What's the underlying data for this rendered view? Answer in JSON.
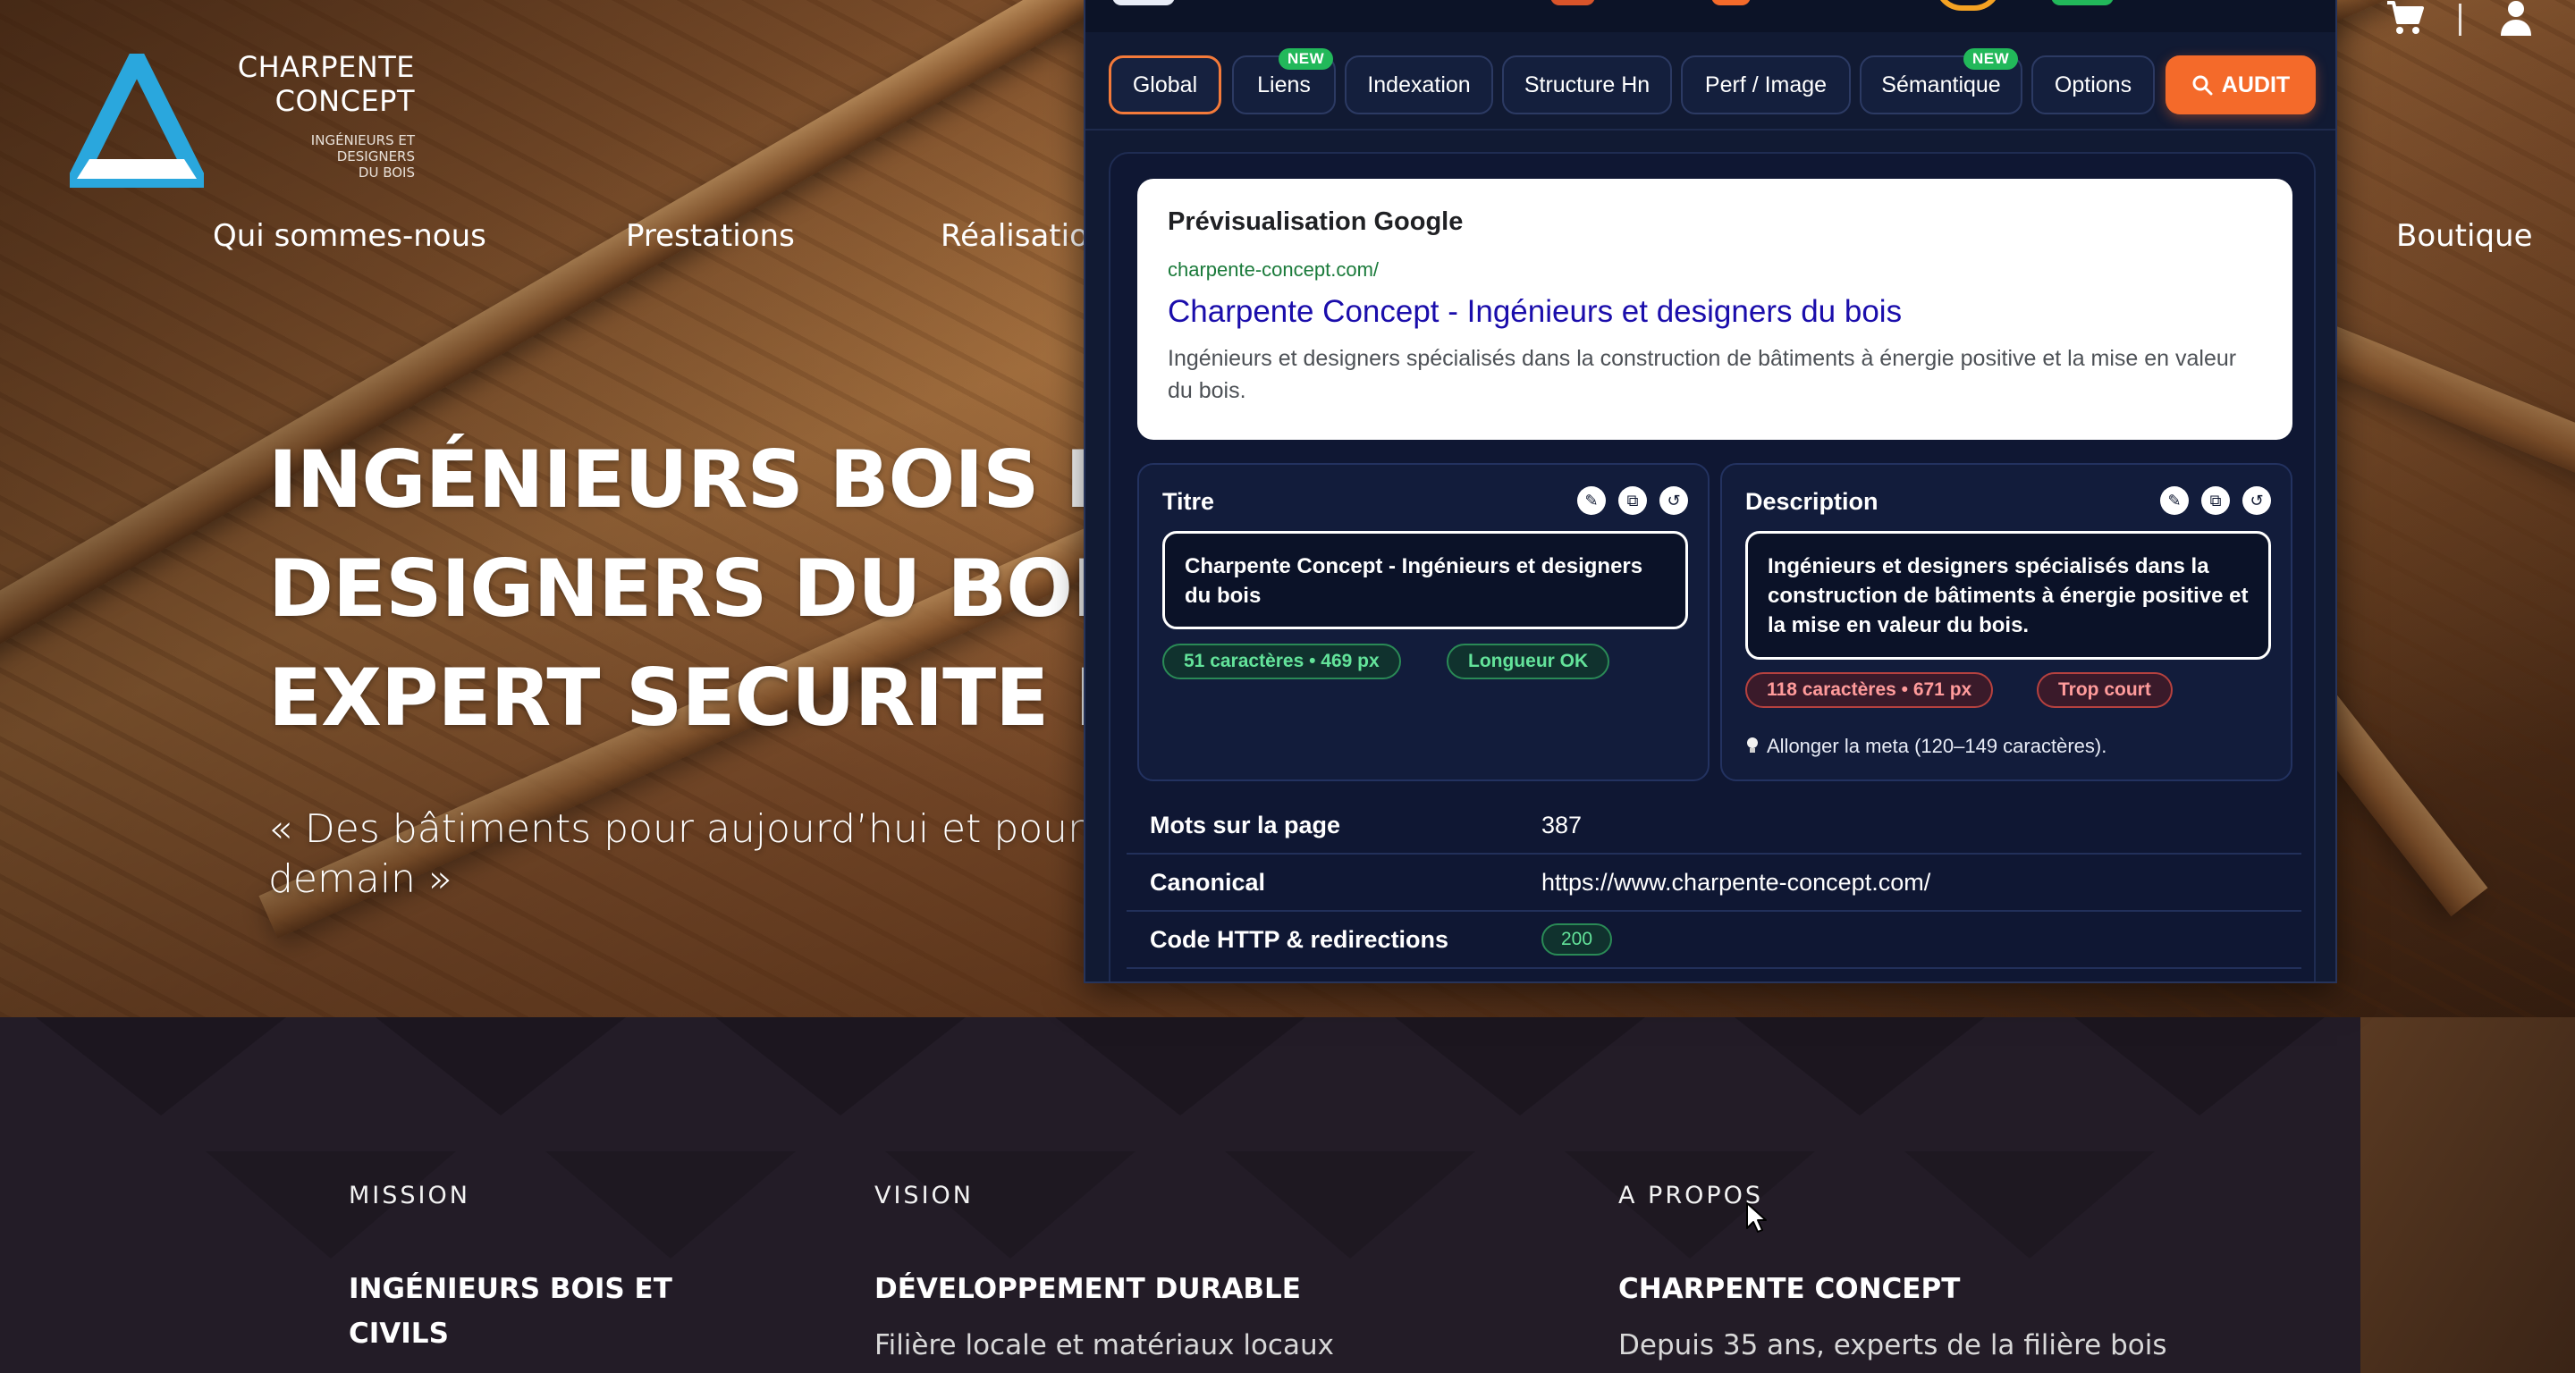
{
  "site": {
    "logo": {
      "title_line1": "CHARPENTE",
      "title_line2": "CONCEPT",
      "subtitle_line1": "INGÉNIEURS ET",
      "subtitle_line2": "DESIGNERS",
      "subtitle_line3": "DU BOIS",
      "colors": {
        "triangle_blue": "#2aa7dd",
        "triangle_white": "#ffffff"
      }
    },
    "nav": {
      "items": [
        {
          "label": "Qui sommes-nous"
        },
        {
          "label": "Prestations"
        },
        {
          "label": "Réalisatio"
        },
        {
          "label": "Boutique"
        }
      ]
    },
    "header_icons": [
      "cart-icon",
      "user-icon"
    ],
    "hero": {
      "title_line1": "INGÉNIEURS BOIS ET",
      "title_line2": "DESIGNERS DU BOIS",
      "title_line3": "EXPERT SECURITE IN",
      "quote": "« Des bâtiments pour aujourd’hui et pour demain »"
    },
    "footer": {
      "columns": [
        {
          "label": "MISSION",
          "heading_line1": "INGÉNIEURS BOIS ET",
          "heading_line2": "CIVILS",
          "text": ""
        },
        {
          "label": "VISION",
          "heading_line1": "DÉVELOPPEMENT DURABLE",
          "heading_line2": "",
          "text": "Filière locale et matériaux locaux"
        },
        {
          "label": "A PROPOS",
          "heading_line1": "CHARPENTE CONCEPT",
          "heading_line2": "",
          "text": "Depuis 35 ans, experts de la filière bois"
        }
      ]
    }
  },
  "seo_panel": {
    "accent_color": "#f46a2a",
    "tabs": [
      {
        "label": "Global",
        "active": true,
        "badge": ""
      },
      {
        "label": "Liens",
        "active": false,
        "badge": "NEW"
      },
      {
        "label": "Indexation",
        "active": false,
        "badge": ""
      },
      {
        "label": "Structure Hn",
        "active": false,
        "badge": ""
      },
      {
        "label": "Perf / Image",
        "active": false,
        "badge": ""
      },
      {
        "label": "Sémantique",
        "active": false,
        "badge": "NEW"
      },
      {
        "label": "Options",
        "active": false,
        "badge": ""
      }
    ],
    "audit_button": {
      "label": "AUDIT",
      "icon": "search-icon"
    },
    "google_preview": {
      "heading": "Prévisualisation Google",
      "url": "charpente-concept.com/",
      "title": "Charpente Concept - Ingénieurs et designers du bois",
      "description": "Ingénieurs et designers spécialisés dans la construction de bâtiments à énergie positive et la mise en valeur du bois."
    },
    "title_card": {
      "heading": "Titre",
      "icons": [
        "pencil-icon",
        "copy-icon",
        "reset-icon"
      ],
      "value": "Charpente Concept - Ingénieurs et designers du bois",
      "stats": "51  caractères •  469  px",
      "status": "Longueur OK"
    },
    "description_card": {
      "heading": "Description",
      "icons": [
        "pencil-icon",
        "copy-icon",
        "reset-icon"
      ],
      "value": "Ingénieurs et designers spécialisés dans la construction de bâtiments à énergie positive et la mise en valeur du bois.",
      "stats": "118  caractères •  671  px",
      "status": "Trop court",
      "hint": "Allonger la meta (120–149 caractères)."
    },
    "rows": [
      {
        "key": "Mots sur la page",
        "value": "387"
      },
      {
        "key": "Canonical",
        "value": "https://www.charpente-concept.com/"
      },
      {
        "key": "Code HTTP & redirections",
        "value": "200"
      }
    ]
  }
}
